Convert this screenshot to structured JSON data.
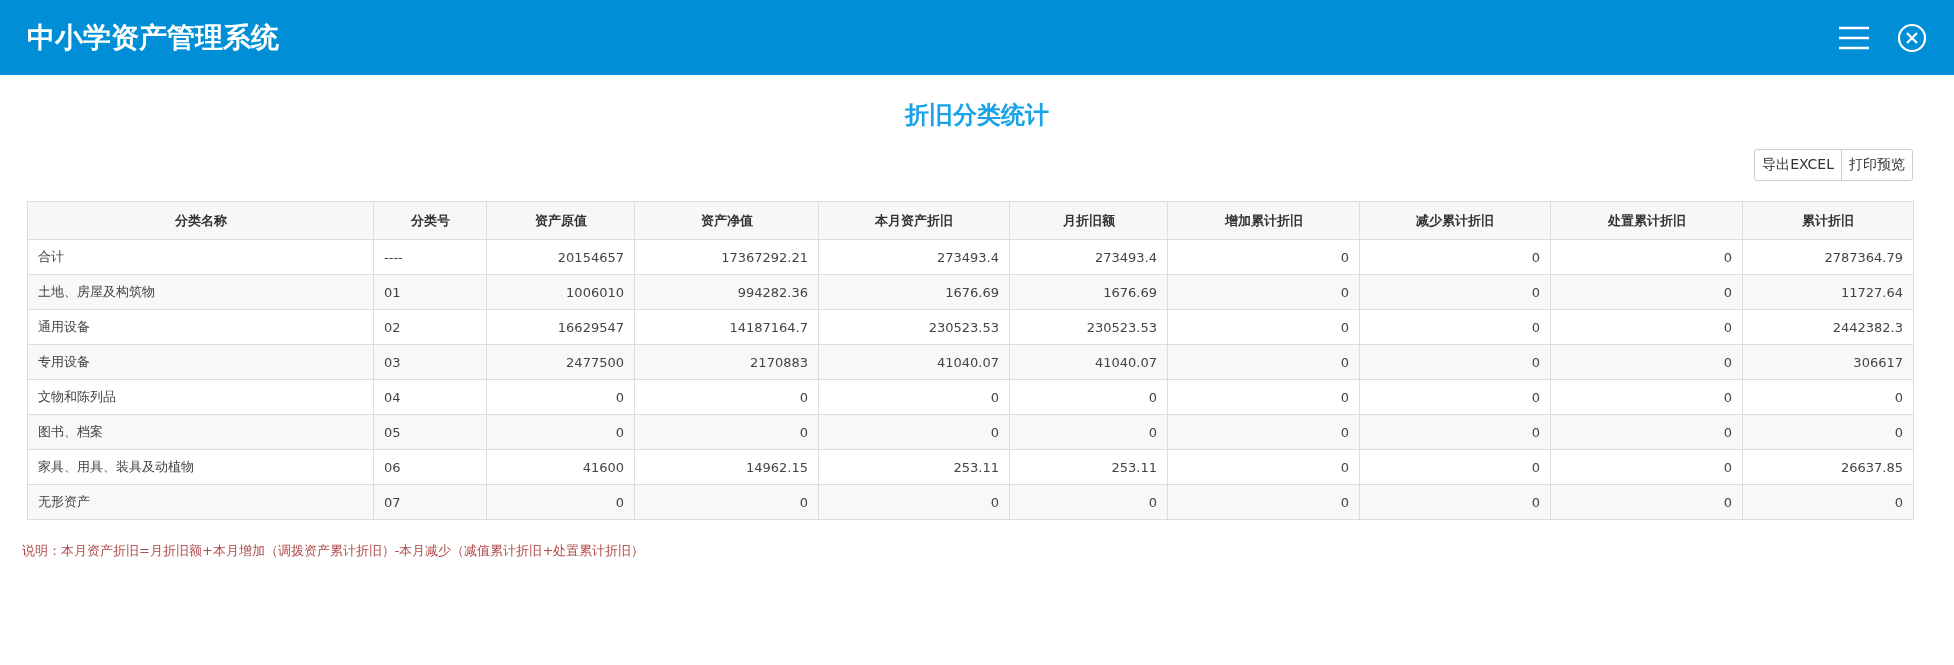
{
  "header": {
    "title": "中小学资产管理系统"
  },
  "report": {
    "title": "折旧分类统计"
  },
  "actions": [
    "导出EXCEL",
    "打印预览"
  ],
  "table": {
    "columns": [
      "分类名称",
      "分类号",
      "资产原值",
      "资产净值",
      "本月资产折旧",
      "月折旧额",
      "增加累计折旧",
      "减少累计折旧",
      "处置累计折旧",
      "累计折旧"
    ],
    "rows": [
      [
        "合计",
        "----",
        "20154657",
        "17367292.21",
        "273493.4",
        "273493.4",
        "0",
        "0",
        "0",
        "2787364.79"
      ],
      [
        "土地、房屋及构筑物",
        "01",
        "1006010",
        "994282.36",
        "1676.69",
        "1676.69",
        "0",
        "0",
        "0",
        "11727.64"
      ],
      [
        "通用设备",
        "02",
        "16629547",
        "14187164.7",
        "230523.53",
        "230523.53",
        "0",
        "0",
        "0",
        "2442382.3"
      ],
      [
        "专用设备",
        "03",
        "2477500",
        "2170883",
        "41040.07",
        "41040.07",
        "0",
        "0",
        "0",
        "306617"
      ],
      [
        "文物和陈列品",
        "04",
        "0",
        "0",
        "0",
        "0",
        "0",
        "0",
        "0",
        "0"
      ],
      [
        "图书、档案",
        "05",
        "0",
        "0",
        "0",
        "0",
        "0",
        "0",
        "0",
        "0"
      ],
      [
        "家具、用具、装具及动植物",
        "06",
        "41600",
        "14962.15",
        "253.11",
        "253.11",
        "0",
        "0",
        "0",
        "26637.85"
      ],
      [
        "无形资产",
        "07",
        "0",
        "0",
        "0",
        "0",
        "0",
        "0",
        "0",
        "0"
      ]
    ]
  },
  "note": "说明：本月资产折旧=月折旧额+本月增加（调拨资产累计折旧）-本月减少（减值累计折旧+处置累计折旧）"
}
